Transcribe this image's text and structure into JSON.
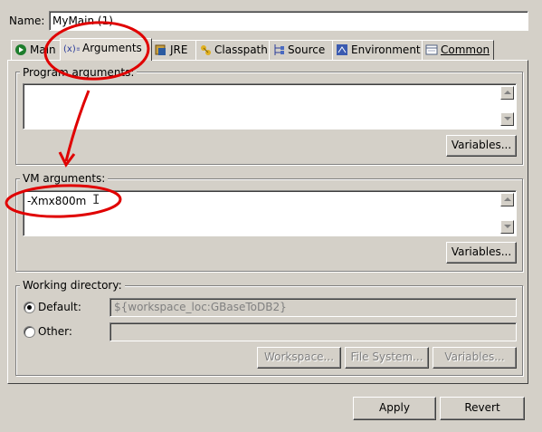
{
  "name": {
    "label": "Name:",
    "value": "MyMain (1)"
  },
  "tabs": [
    {
      "label": "Main",
      "icon": "main-launch-icon"
    },
    {
      "label": "Arguments",
      "icon": "arguments-icon",
      "active": true
    },
    {
      "label": "JRE",
      "icon": "jre-icon"
    },
    {
      "label": "Classpath",
      "icon": "classpath-icon"
    },
    {
      "label": "Source",
      "icon": "source-icon"
    },
    {
      "label": "Environment",
      "icon": "environment-icon"
    },
    {
      "label": "Common",
      "icon": "common-icon"
    }
  ],
  "program_args": {
    "label": "Program arguments:",
    "value": "",
    "variables_label": "Variables..."
  },
  "vm_args": {
    "label": "VM arguments:",
    "value": "-Xmx800m",
    "variables_label": "Variables..."
  },
  "working_dir": {
    "label": "Working directory:",
    "default_label": "Default:",
    "default_value": "${workspace_loc:GBaseToDB2}",
    "other_label": "Other:",
    "other_value": "",
    "workspace_label": "Workspace...",
    "filesystem_label": "File System...",
    "variables_label": "Variables..."
  },
  "footer": {
    "apply_label": "Apply",
    "revert_label": "Revert"
  },
  "annotation_color": "#e00000"
}
